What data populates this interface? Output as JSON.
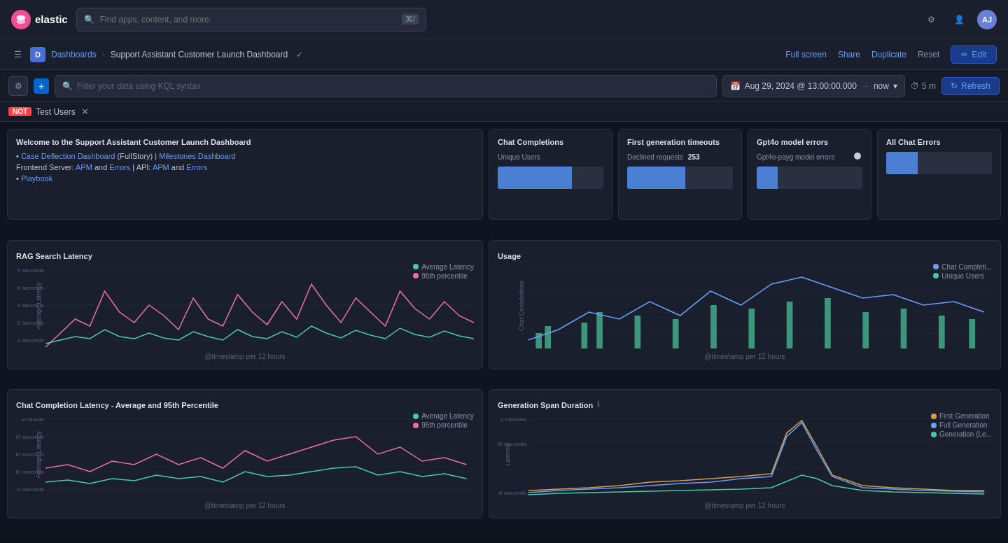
{
  "app": {
    "logo_text": "elastic",
    "logo_initial": "e",
    "search_placeholder": "Find apps, content, and more.",
    "search_shortcut": "⌘/",
    "avatar_initials": "AJ"
  },
  "breadcrumb": {
    "d_label": "D",
    "dashboards_label": "Dashboards",
    "current_label": "Support Assistant Customer Launch Dashboard"
  },
  "header_actions": {
    "full_screen": "Full screen",
    "share": "Share",
    "duplicate": "Duplicate",
    "reset": "Reset",
    "edit": "Edit"
  },
  "filter_bar": {
    "kql_placeholder": "Filter your data using KQL syntax",
    "date_range": "Aug 29, 2024 @ 13:00:00.000",
    "date_to": "now",
    "interval": "5 m",
    "refresh": "Refresh"
  },
  "tag_filter": {
    "not_label": "NOT",
    "tag_label": "Test Users"
  },
  "welcome": {
    "title": "Welcome to the Support Assistant Customer Launch Dashboard",
    "links": [
      {
        "text": "Case Deflection Dashboard",
        "type": "link"
      },
      {
        "middle": " (FullStory) | ",
        "type": "text"
      },
      {
        "text": "Milestones Dashboard",
        "type": "link2"
      },
      {
        "line2a": "Frontend Server: ",
        "apm1": "APM",
        "and1": " and ",
        "err1": "Errors",
        "pipe": " | API: ",
        "apm2": "APM",
        "and2": " and ",
        "err2": "Errors"
      },
      {
        "text": "Playbook",
        "type": "playbook"
      }
    ]
  },
  "metrics": {
    "chat_completions": {
      "title": "Chat Completions",
      "label": "Unique Users",
      "value": ""
    },
    "first_generation": {
      "title": "First generation timeouts",
      "subtitle": "",
      "label": "Declined requests",
      "value": "253"
    },
    "gpt4o_errors": {
      "title": "Gpt4o model errors",
      "label": "Gpt4o-payg model errors",
      "value": ""
    },
    "all_chat_errors": {
      "title": "All Chat Errors",
      "label": "",
      "value": ""
    }
  },
  "charts": {
    "rag_search_latency": {
      "title": "RAG Search Latency",
      "xlabel": "@timestamp per 12 hours",
      "ylabel": "Average Latency",
      "legend": [
        {
          "label": "Average Latency",
          "color": "#4ac9a0"
        },
        {
          "label": "95th percentile",
          "color": "#e86fa0"
        }
      ]
    },
    "usage": {
      "title": "Usage",
      "xlabel": "@timestamp per 12 hours",
      "ylabel": "Chat Completions",
      "legend": [
        {
          "label": "Chat Completi...",
          "color": "#6b9dfc"
        },
        {
          "label": "Unique Users",
          "color": "#4ac9a0"
        }
      ]
    },
    "chat_completion_latency": {
      "title": "Chat Completion Latency - Average and 95th Percentile",
      "xlabel": "@timestamp per 12 hours",
      "ylabel": "Average Latency",
      "legend": [
        {
          "label": "Average Latency",
          "color": "#4ac9a0"
        },
        {
          "label": "95th percentile",
          "color": "#e86fa0"
        }
      ]
    },
    "generation_span": {
      "title": "Generation Span Duration",
      "xlabel": "@timestamp per 12 hours",
      "ylabel": "Latency",
      "legend": [
        {
          "label": "First Generation",
          "color": "#d4a04a"
        },
        {
          "label": "Full Generation",
          "color": "#6b9dfc"
        },
        {
          "label": "Generation (Le...",
          "color": "#4ac9a0"
        }
      ]
    }
  }
}
